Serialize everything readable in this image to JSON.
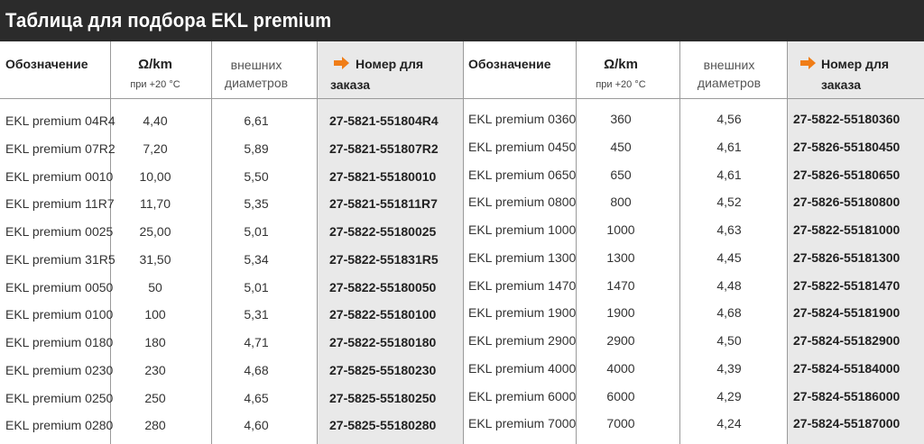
{
  "title": "Таблица для подбора EKL premium",
  "headers": {
    "designation": "Обозначение",
    "resistance": "Ω/km",
    "resistance_note": "при +20 °C",
    "diameter_line1": "внешних",
    "diameter_line2": "диаметров",
    "order_line1": "Номер для",
    "order_line2": "заказа",
    "order_arrow_icon": "arrow-right-icon",
    "accent_color": "#f07d17"
  },
  "left_rows": [
    {
      "name": "EKL premium  04R4",
      "resistance": "4,40",
      "diameter": "6,61",
      "order": "27-5821-551804R4"
    },
    {
      "name": "EKL premium  07R2",
      "resistance": "7,20",
      "diameter": "5,89",
      "order": "27-5821-551807R2"
    },
    {
      "name": "EKL premium  0010",
      "resistance": "10,00",
      "diameter": "5,50",
      "order": "27-5821-55180010"
    },
    {
      "name": "EKL premium  11R7",
      "resistance": "11,70",
      "diameter": "5,35",
      "order": "27-5821-551811R7"
    },
    {
      "name": "EKL premium  0025",
      "resistance": "25,00",
      "diameter": "5,01",
      "order": "27-5822-55180025"
    },
    {
      "name": "EKL premium  31R5",
      "resistance": "31,50",
      "diameter": "5,34",
      "order": "27-5822-551831R5"
    },
    {
      "name": "EKL premium  0050",
      "resistance": "50",
      "diameter": "5,01",
      "order": "27-5822-55180050"
    },
    {
      "name": "EKL premium  0100",
      "resistance": "100",
      "diameter": "5,31",
      "order": "27-5822-55180100"
    },
    {
      "name": "EKL premium  0180",
      "resistance": "180",
      "diameter": "4,71",
      "order": "27-5822-55180180"
    },
    {
      "name": "EKL premium  0230",
      "resistance": "230",
      "diameter": "4,68",
      "order": "27-5825-55180230"
    },
    {
      "name": "EKL premium  0250",
      "resistance": "250",
      "diameter": "4,65",
      "order": "27-5825-55180250"
    },
    {
      "name": "EKL premium  0280",
      "resistance": "280",
      "diameter": "4,60",
      "order": "27-5825-55180280"
    }
  ],
  "right_rows": [
    {
      "name": "EKL premium  0360",
      "resistance": "360",
      "diameter": "4,56",
      "order": "27-5822-55180360"
    },
    {
      "name": "EKL premium  0450",
      "resistance": "450",
      "diameter": "4,61",
      "order": "27-5826-55180450"
    },
    {
      "name": "EKL premium  0650",
      "resistance": "650",
      "diameter": "4,61",
      "order": "27-5826-55180650"
    },
    {
      "name": "EKL premium  0800",
      "resistance": "800",
      "diameter": "4,52",
      "order": "27-5826-55180800"
    },
    {
      "name": "EKL premium  1000",
      "resistance": "1000",
      "diameter": "4,63",
      "order": "27-5822-55181000"
    },
    {
      "name": "EKL premium  1300",
      "resistance": "1300",
      "diameter": "4,45",
      "order": "27-5826-55181300"
    },
    {
      "name": "EKL premium  1470",
      "resistance": "1470",
      "diameter": "4,48",
      "order": "27-5822-55181470"
    },
    {
      "name": "EKL premium  1900",
      "resistance": "1900",
      "diameter": "4,68",
      "order": "27-5824-55181900"
    },
    {
      "name": "EKL premium  2900",
      "resistance": "2900",
      "diameter": "4,50",
      "order": "27-5824-55182900"
    },
    {
      "name": "EKL premium  4000",
      "resistance": "4000",
      "diameter": "4,39",
      "order": "27-5824-55184000"
    },
    {
      "name": "EKL premium  6000",
      "resistance": "6000",
      "diameter": "4,29",
      "order": "27-5824-55186000"
    },
    {
      "name": "EKL premium  7000",
      "resistance": "7000",
      "diameter": "4,24",
      "order": "27-5824-55187000"
    }
  ]
}
